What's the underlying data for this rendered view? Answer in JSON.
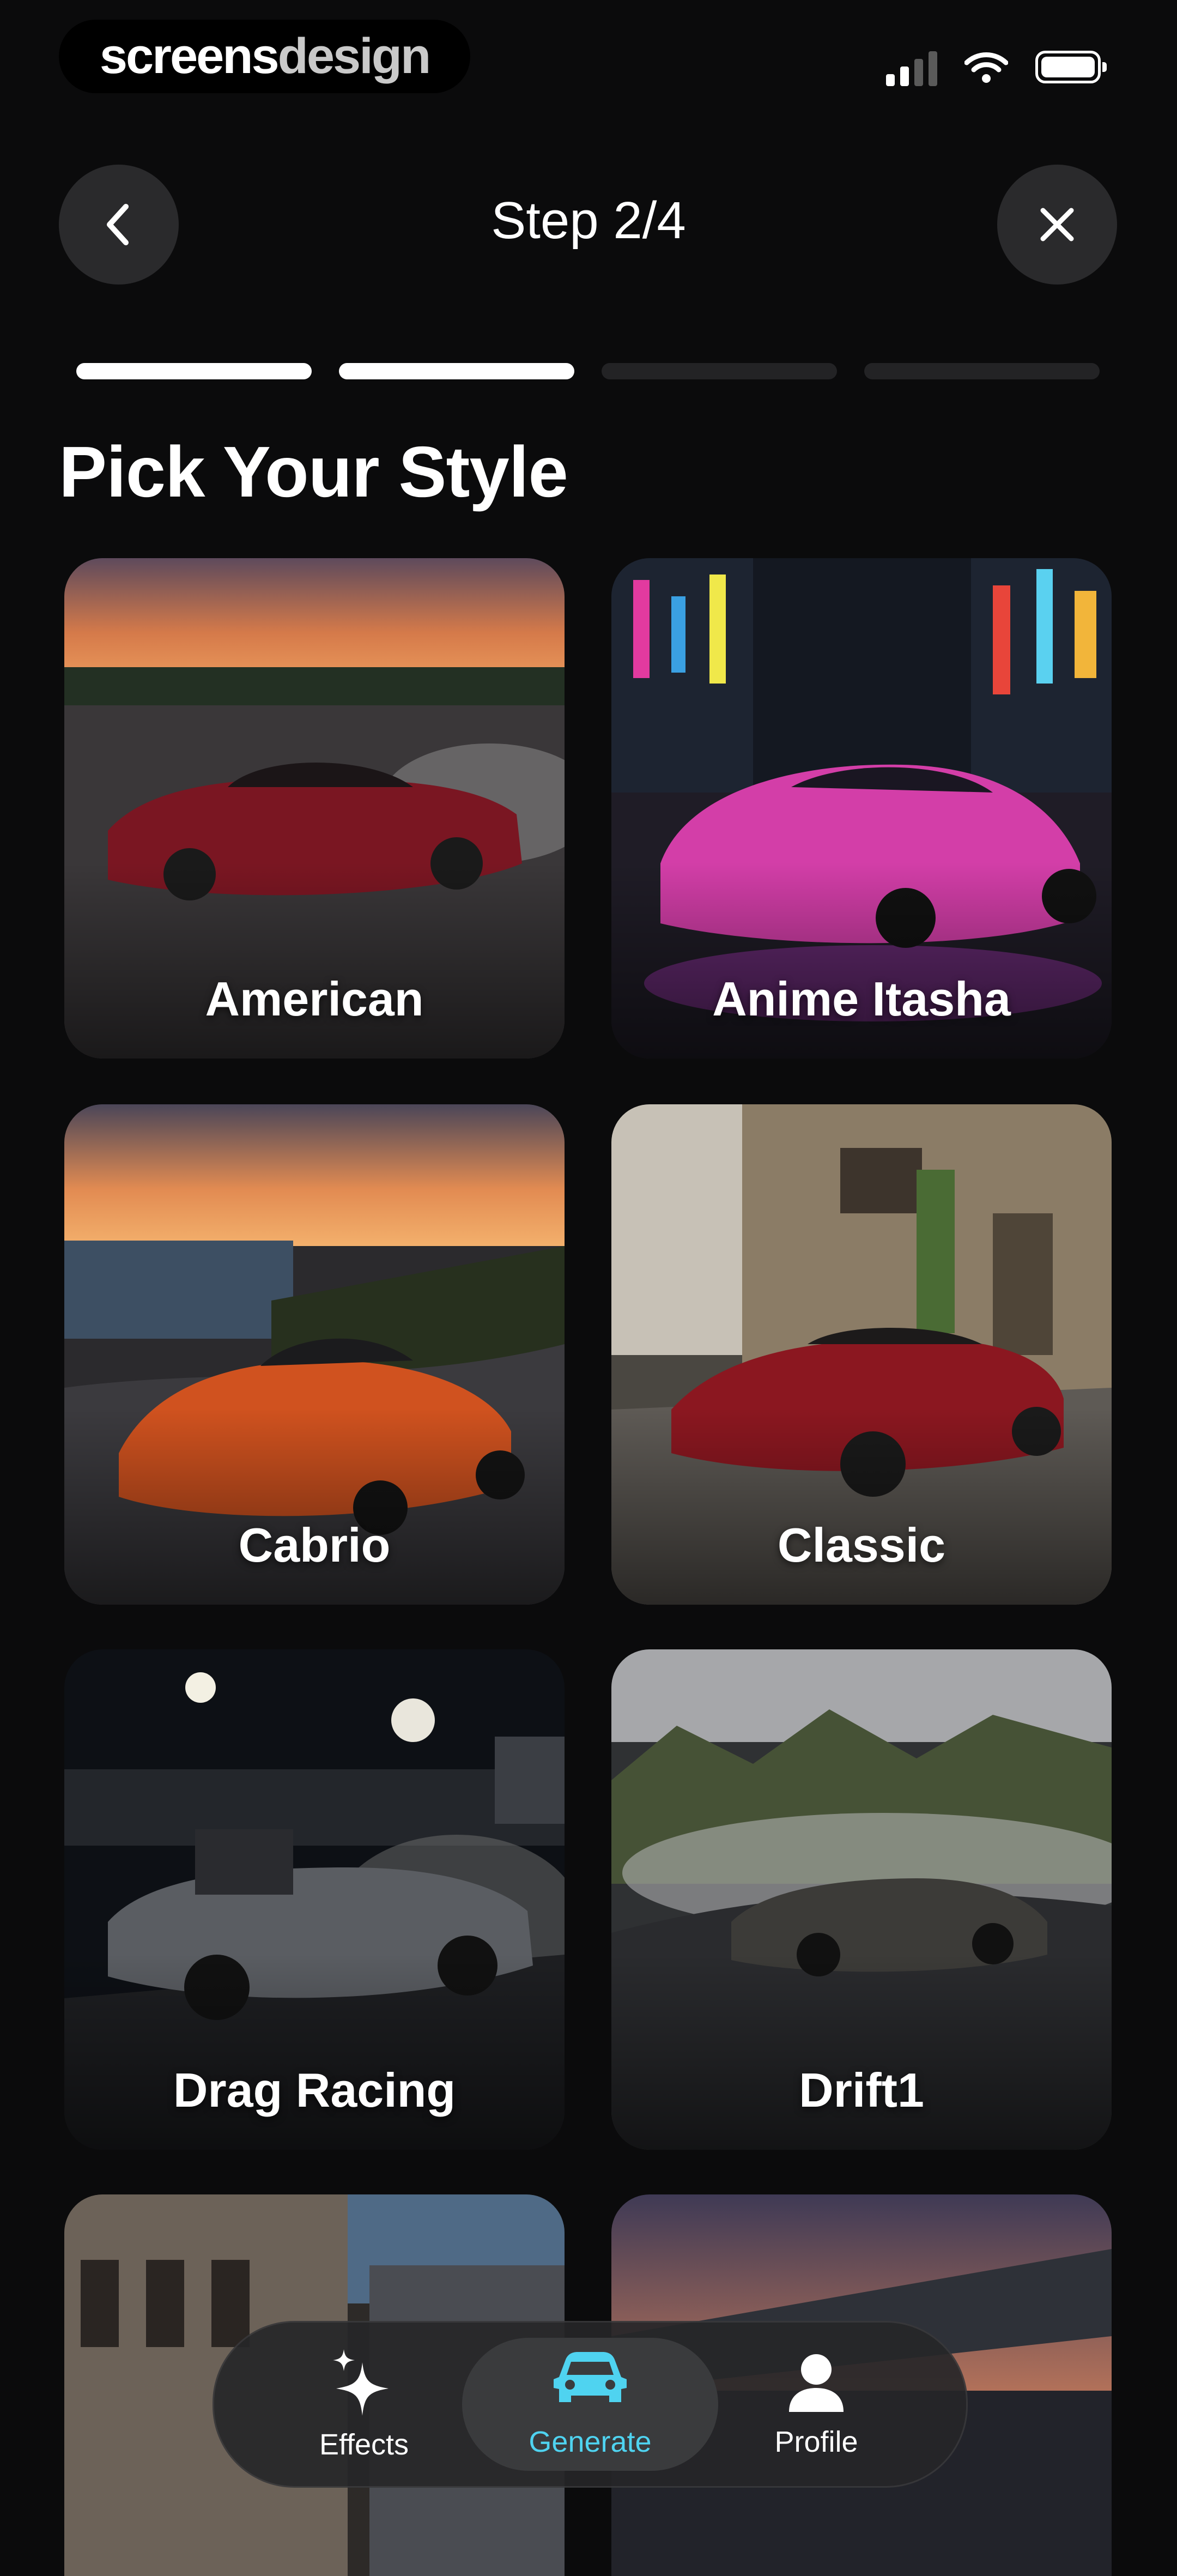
{
  "status_bar": {
    "brand_part1": "screens",
    "brand_part2": "design"
  },
  "header": {
    "title": "Step 2/4",
    "back_icon": "chevron-left-icon",
    "close_icon": "close-icon"
  },
  "progress": {
    "current_step": 2,
    "total_steps": 4,
    "active_color": "#ffffff",
    "inactive_color": "#232325"
  },
  "section_title": "Pick Your Style",
  "styles": [
    {
      "label": "American"
    },
    {
      "label": "Anime Itasha"
    },
    {
      "label": "Cabrio"
    },
    {
      "label": "Classic"
    },
    {
      "label": "Drag Racing"
    },
    {
      "label": "Drift1"
    }
  ],
  "nav": {
    "items": [
      {
        "label": "Effects",
        "icon": "sparkles-icon",
        "active": false
      },
      {
        "label": "Generate",
        "icon": "car-icon",
        "active": true
      },
      {
        "label": "Profile",
        "icon": "person-icon",
        "active": false
      }
    ],
    "accent_color": "#4fd3f0"
  }
}
